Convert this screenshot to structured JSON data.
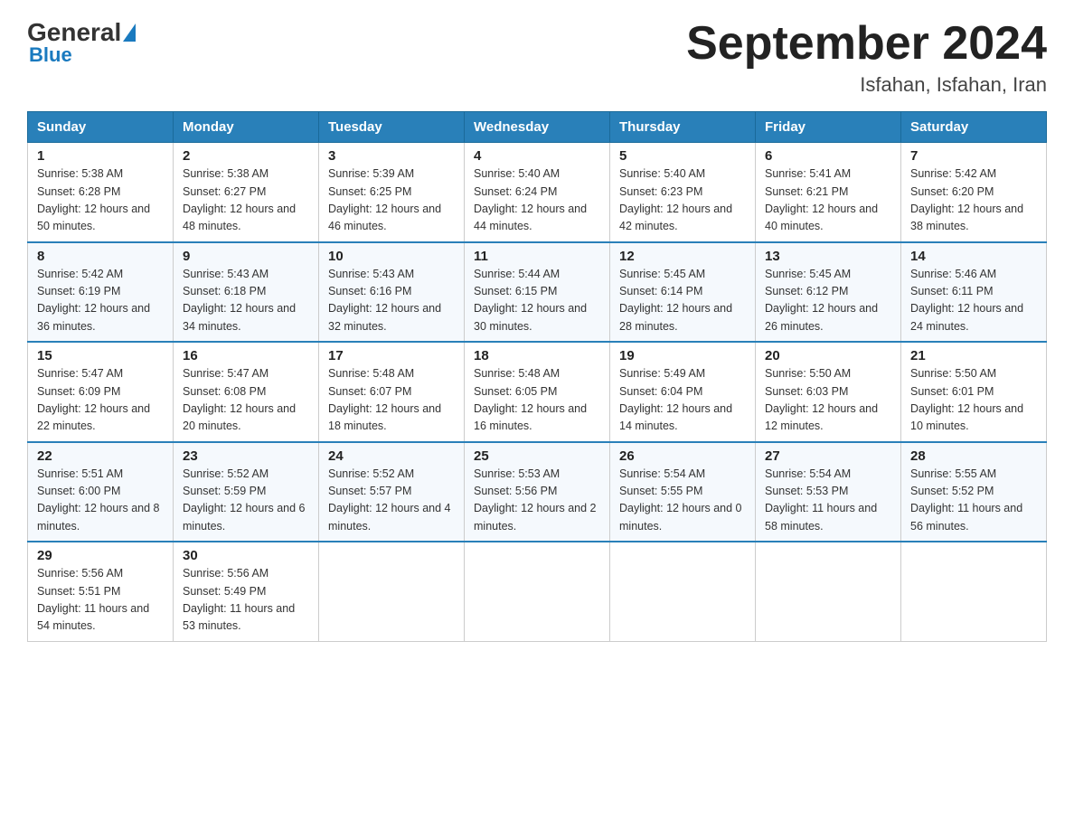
{
  "header": {
    "logo_general": "General",
    "logo_blue": "Blue",
    "main_title": "September 2024",
    "subtitle": "Isfahan, Isfahan, Iran"
  },
  "calendar": {
    "days_of_week": [
      "Sunday",
      "Monday",
      "Tuesday",
      "Wednesday",
      "Thursday",
      "Friday",
      "Saturday"
    ],
    "weeks": [
      [
        {
          "date": "1",
          "sunrise": "5:38 AM",
          "sunset": "6:28 PM",
          "daylight": "12 hours and 50 minutes."
        },
        {
          "date": "2",
          "sunrise": "5:38 AM",
          "sunset": "6:27 PM",
          "daylight": "12 hours and 48 minutes."
        },
        {
          "date": "3",
          "sunrise": "5:39 AM",
          "sunset": "6:25 PM",
          "daylight": "12 hours and 46 minutes."
        },
        {
          "date": "4",
          "sunrise": "5:40 AM",
          "sunset": "6:24 PM",
          "daylight": "12 hours and 44 minutes."
        },
        {
          "date": "5",
          "sunrise": "5:40 AM",
          "sunset": "6:23 PM",
          "daylight": "12 hours and 42 minutes."
        },
        {
          "date": "6",
          "sunrise": "5:41 AM",
          "sunset": "6:21 PM",
          "daylight": "12 hours and 40 minutes."
        },
        {
          "date": "7",
          "sunrise": "5:42 AM",
          "sunset": "6:20 PM",
          "daylight": "12 hours and 38 minutes."
        }
      ],
      [
        {
          "date": "8",
          "sunrise": "5:42 AM",
          "sunset": "6:19 PM",
          "daylight": "12 hours and 36 minutes."
        },
        {
          "date": "9",
          "sunrise": "5:43 AM",
          "sunset": "6:18 PM",
          "daylight": "12 hours and 34 minutes."
        },
        {
          "date": "10",
          "sunrise": "5:43 AM",
          "sunset": "6:16 PM",
          "daylight": "12 hours and 32 minutes."
        },
        {
          "date": "11",
          "sunrise": "5:44 AM",
          "sunset": "6:15 PM",
          "daylight": "12 hours and 30 minutes."
        },
        {
          "date": "12",
          "sunrise": "5:45 AM",
          "sunset": "6:14 PM",
          "daylight": "12 hours and 28 minutes."
        },
        {
          "date": "13",
          "sunrise": "5:45 AM",
          "sunset": "6:12 PM",
          "daylight": "12 hours and 26 minutes."
        },
        {
          "date": "14",
          "sunrise": "5:46 AM",
          "sunset": "6:11 PM",
          "daylight": "12 hours and 24 minutes."
        }
      ],
      [
        {
          "date": "15",
          "sunrise": "5:47 AM",
          "sunset": "6:09 PM",
          "daylight": "12 hours and 22 minutes."
        },
        {
          "date": "16",
          "sunrise": "5:47 AM",
          "sunset": "6:08 PM",
          "daylight": "12 hours and 20 minutes."
        },
        {
          "date": "17",
          "sunrise": "5:48 AM",
          "sunset": "6:07 PM",
          "daylight": "12 hours and 18 minutes."
        },
        {
          "date": "18",
          "sunrise": "5:48 AM",
          "sunset": "6:05 PM",
          "daylight": "12 hours and 16 minutes."
        },
        {
          "date": "19",
          "sunrise": "5:49 AM",
          "sunset": "6:04 PM",
          "daylight": "12 hours and 14 minutes."
        },
        {
          "date": "20",
          "sunrise": "5:50 AM",
          "sunset": "6:03 PM",
          "daylight": "12 hours and 12 minutes."
        },
        {
          "date": "21",
          "sunrise": "5:50 AM",
          "sunset": "6:01 PM",
          "daylight": "12 hours and 10 minutes."
        }
      ],
      [
        {
          "date": "22",
          "sunrise": "5:51 AM",
          "sunset": "6:00 PM",
          "daylight": "12 hours and 8 minutes."
        },
        {
          "date": "23",
          "sunrise": "5:52 AM",
          "sunset": "5:59 PM",
          "daylight": "12 hours and 6 minutes."
        },
        {
          "date": "24",
          "sunrise": "5:52 AM",
          "sunset": "5:57 PM",
          "daylight": "12 hours and 4 minutes."
        },
        {
          "date": "25",
          "sunrise": "5:53 AM",
          "sunset": "5:56 PM",
          "daylight": "12 hours and 2 minutes."
        },
        {
          "date": "26",
          "sunrise": "5:54 AM",
          "sunset": "5:55 PM",
          "daylight": "12 hours and 0 minutes."
        },
        {
          "date": "27",
          "sunrise": "5:54 AM",
          "sunset": "5:53 PM",
          "daylight": "11 hours and 58 minutes."
        },
        {
          "date": "28",
          "sunrise": "5:55 AM",
          "sunset": "5:52 PM",
          "daylight": "11 hours and 56 minutes."
        }
      ],
      [
        {
          "date": "29",
          "sunrise": "5:56 AM",
          "sunset": "5:51 PM",
          "daylight": "11 hours and 54 minutes."
        },
        {
          "date": "30",
          "sunrise": "5:56 AM",
          "sunset": "5:49 PM",
          "daylight": "11 hours and 53 minutes."
        },
        null,
        null,
        null,
        null,
        null
      ]
    ]
  }
}
